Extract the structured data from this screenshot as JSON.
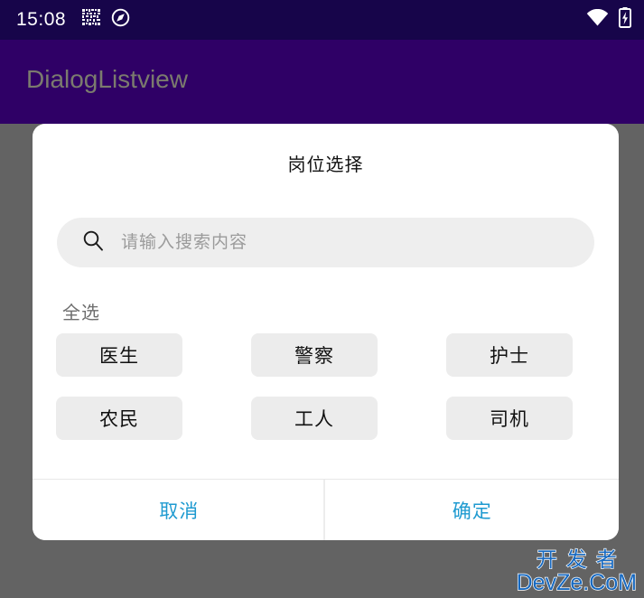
{
  "status_bar": {
    "clock": "15:08",
    "left_icons": [
      "qr-code-icon",
      "navigation-circle-icon"
    ],
    "right_icons": [
      "wifi-icon",
      "battery-charging-icon"
    ],
    "background_color": "#17054a",
    "foreground_color": "#ffffff"
  },
  "app_bar": {
    "title": "DialogListview",
    "background_color": "#2f0066",
    "title_color": "#7b7b6e"
  },
  "scrim": {
    "color": "#636363"
  },
  "dialog": {
    "title": "岗位选择",
    "search": {
      "icon": "search-icon",
      "value": "",
      "placeholder": "请输入搜索内容",
      "background_color": "#eeeeee"
    },
    "select_all_label": "全选",
    "chips": [
      {
        "label": "医生"
      },
      {
        "label": "警察"
      },
      {
        "label": "护士"
      },
      {
        "label": "农民"
      },
      {
        "label": "工人"
      },
      {
        "label": "司机"
      }
    ],
    "footer": {
      "cancel_label": "取消",
      "confirm_label": "确定",
      "action_color": "#1e9ad0"
    },
    "background_color": "#ffffff",
    "chip_color": "#ececec"
  },
  "watermark": {
    "line1": "开发者",
    "line2": "DevZe.CoM",
    "color": "#1769c0"
  }
}
